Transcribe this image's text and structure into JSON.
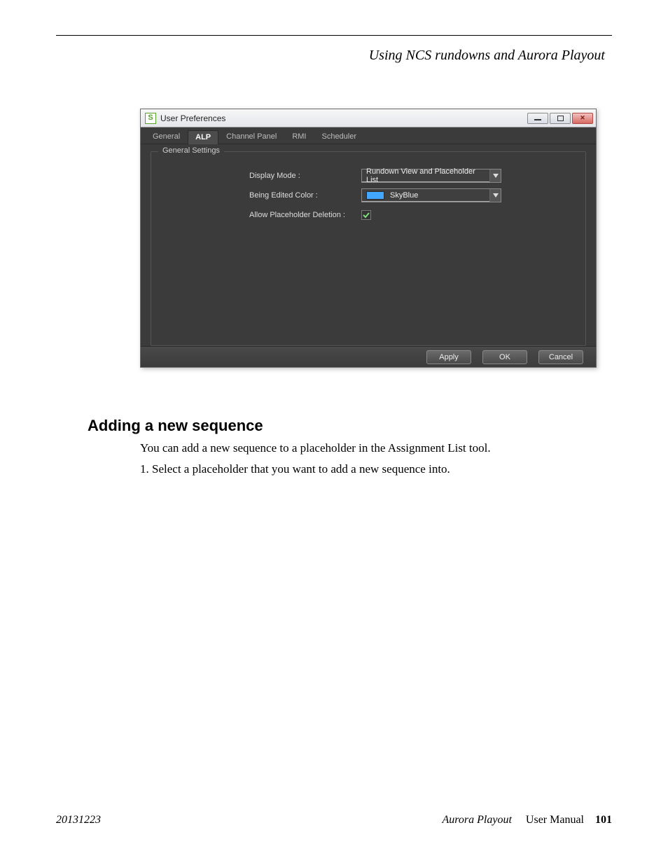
{
  "chapter_title": "Using NCS rundowns and Aurora Playout",
  "dialog": {
    "title": "User Preferences",
    "app_icon_letter": "S",
    "tabs": [
      "General",
      "ALP",
      "Channel Panel",
      "RMI",
      "Scheduler"
    ],
    "active_tab_index": 1,
    "section_title": "General Settings",
    "fields": {
      "display_mode": {
        "label": "Display Mode :",
        "value": "Rundown View and Placeholder List"
      },
      "being_edited_color": {
        "label": "Being Edited Color :",
        "value": "SkyBlue",
        "swatch": "#41a7ff"
      },
      "allow_placeholder_deletion": {
        "label": "Allow Placeholder Deletion :",
        "checked": true
      }
    },
    "buttons": {
      "apply": "Apply",
      "ok": "OK",
      "cancel": "Cancel"
    }
  },
  "body": {
    "heading": "Adding a new sequence",
    "intro": "You can add a new sequence to a placeholder in the Assignment List tool.",
    "step1": "1.  Select a placeholder that you want to add a new sequence into."
  },
  "footer": {
    "left": "20131223",
    "book": "Aurora Playout",
    "section": "User Manual",
    "page": "101"
  }
}
